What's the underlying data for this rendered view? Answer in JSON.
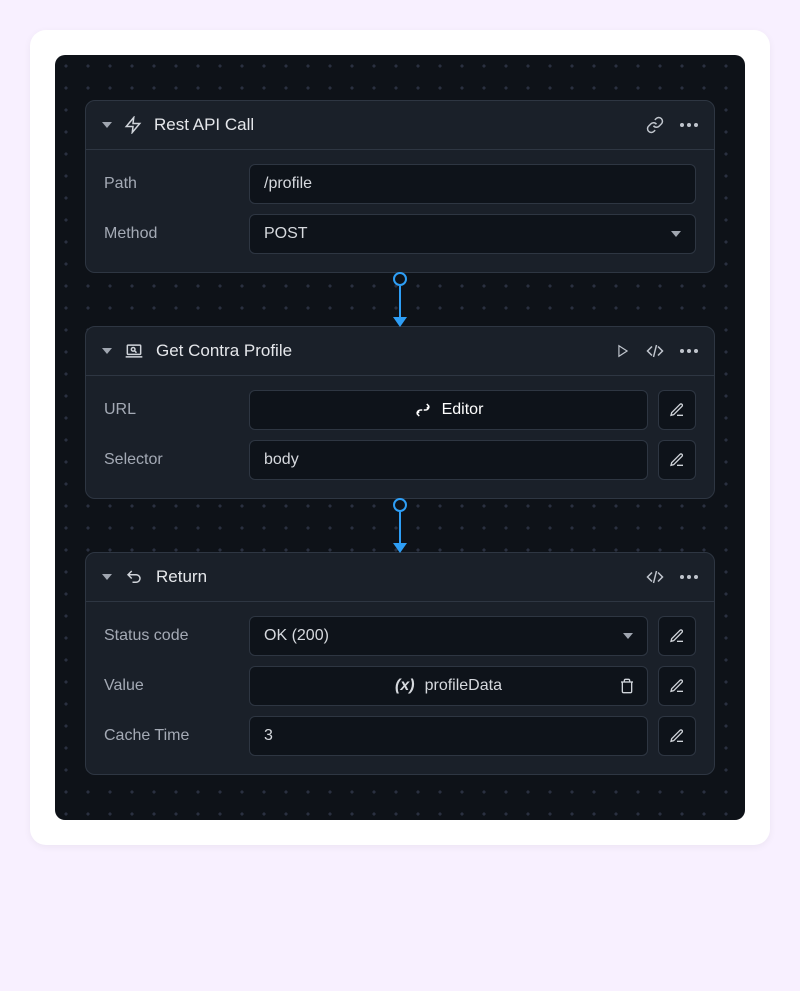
{
  "nodes": {
    "restApi": {
      "title": "Rest API Call",
      "path_label": "Path",
      "path_value": "/profile",
      "method_label": "Method",
      "method_value": "POST"
    },
    "profile": {
      "title": "Get Contra Profile",
      "url_label": "URL",
      "url_editor": "Editor",
      "selector_label": "Selector",
      "selector_value": "body"
    },
    "ret": {
      "title": "Return",
      "status_label": "Status code",
      "status_value": "OK (200)",
      "value_label": "Value",
      "value_var": "profileData",
      "cache_label": "Cache Time",
      "cache_value": "3"
    }
  }
}
